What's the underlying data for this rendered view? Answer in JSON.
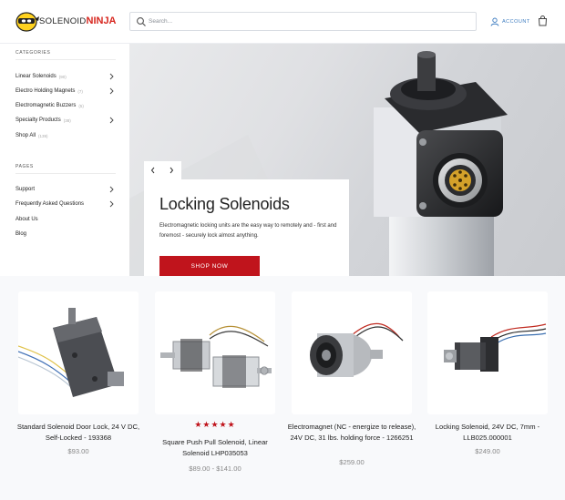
{
  "header": {
    "logo": {
      "word1": "SOLENOID",
      "word2": "NINJA"
    },
    "search": {
      "placeholder": "Search..."
    },
    "account_label": "ACCOUNT"
  },
  "sidebar": {
    "categories_title": "CATEGORIES",
    "categories": [
      {
        "label": "Linear Solenoids",
        "count": "(90)",
        "has_children": true
      },
      {
        "label": "Electro Holding Magnets",
        "count": "(7)",
        "has_children": true
      },
      {
        "label": "Electromagnetic Buzzers",
        "count": "(5)",
        "has_children": false
      },
      {
        "label": "Specialty Products",
        "count": "(38)",
        "has_children": true
      },
      {
        "label": "Shop All",
        "count": "(139)",
        "has_children": false
      }
    ],
    "pages_title": "PAGES",
    "pages": [
      {
        "label": "Support",
        "has_children": true
      },
      {
        "label": "Frequently Asked Questions",
        "has_children": true
      },
      {
        "label": "About Us",
        "has_children": false
      },
      {
        "label": "Blog",
        "has_children": false
      }
    ]
  },
  "hero": {
    "title": "Locking Solenoids",
    "description": "Electromagnetic locking units are the easy way to remotely and - first and foremost - securely lock almost anything.",
    "button_label": "SHOP NOW"
  },
  "products": [
    {
      "name": "Standard Solenoid Door Lock, 24 V DC, Self-Locked - 193368",
      "price": "$93.00",
      "rating": 0,
      "stars": ""
    },
    {
      "name": "Square Push Pull Solenoid, Linear Solenoid LHP035053",
      "price": "$89.00 - $141.00",
      "rating": 5,
      "stars": "★★★★★"
    },
    {
      "name": "Electromagnet (NC - energize to release), 24V DC, 31 lbs. holding force - 1266251",
      "price": "$259.00",
      "rating": 0,
      "stars": ""
    },
    {
      "name": "Locking Solenoid, 24V DC, 7mm - LLB025.000001",
      "price": "$249.00",
      "rating": 0,
      "stars": ""
    }
  ],
  "colors": {
    "brand_red": "#c0141c",
    "accent_blue": "#3b7bc0",
    "logo_yellow": "#ffd21f"
  }
}
